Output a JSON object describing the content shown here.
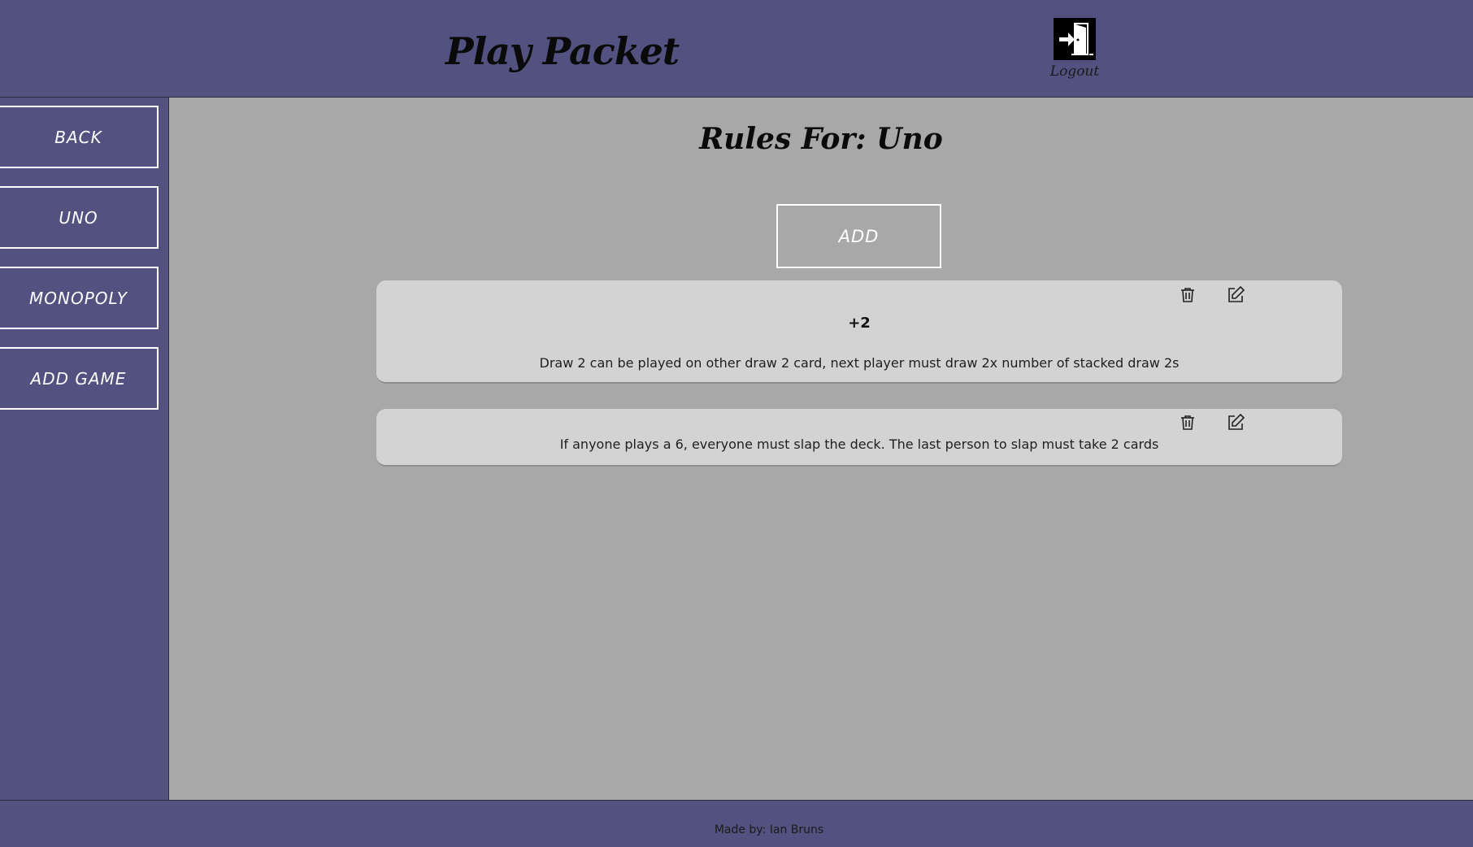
{
  "header": {
    "app_title": "Play Packet",
    "logout_label": "Logout",
    "logout_icon": "exit-door-icon"
  },
  "sidebar": {
    "items": [
      {
        "label": "BACK"
      },
      {
        "label": "UNO"
      },
      {
        "label": "MONOPOLY"
      },
      {
        "label": "ADD GAME"
      }
    ]
  },
  "main": {
    "title": "Rules For: Uno",
    "add_label": "ADD",
    "rules": [
      {
        "title": "+2",
        "description": "Draw 2 can be played on other draw 2 card, next player must draw 2x number of stacked draw 2s",
        "icons": [
          "trash-icon",
          "edit-icon"
        ]
      },
      {
        "title": "",
        "description": "If anyone plays a 6, everyone must slap the deck. The last person to slap must take 2 cards",
        "icons": [
          "trash-icon",
          "edit-icon"
        ]
      }
    ]
  },
  "footer": {
    "text": "Made by: Ian Bruns"
  },
  "colors": {
    "header_bg": "#53517f",
    "content_bg": "#a8a8a8",
    "card_bg": "#d3d3d3",
    "button_border": "#ffffff"
  }
}
